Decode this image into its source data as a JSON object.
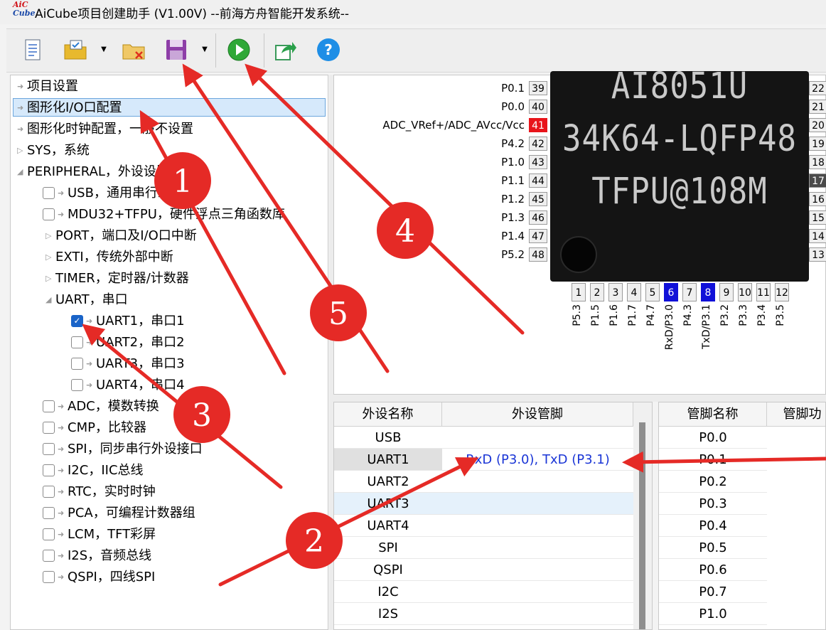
{
  "window": {
    "logo_text_top": "AiC",
    "logo_text_bottom": "Cube",
    "title": "AiCube项目创建助手 (V1.00V) --前海方舟智能开发系统--"
  },
  "toolbar": {
    "buttons": [
      {
        "icon": "new-document-icon"
      },
      {
        "icon": "open-folder-icon",
        "dropdown": true
      },
      {
        "icon": "close-project-icon"
      },
      {
        "icon": "save-icon",
        "dropdown": true
      },
      {
        "icon": "run-generate-icon"
      },
      {
        "icon": "export-icon"
      },
      {
        "icon": "help-icon"
      }
    ],
    "dropdown_glyph": "▼"
  },
  "tree": {
    "items": [
      {
        "label": "项目设置"
      },
      {
        "label": "图形化I/O口配置"
      },
      {
        "label": "图形化时钟配置，一般不设置"
      },
      {
        "label": "SYS，系统"
      },
      {
        "label": "PERIPHERAL，外设设置"
      },
      {
        "label": "USB，通用串行总线"
      },
      {
        "label": "MDU32+TFPU，硬件浮点三角函数库"
      },
      {
        "label": "PORT，端口及I/O口中断"
      },
      {
        "label": "EXTI，传统外部中断"
      },
      {
        "label": "TIMER，定时器/计数器"
      },
      {
        "label": "UART，串口"
      },
      {
        "label": "UART1，串口1"
      },
      {
        "label": "UART2，串口2"
      },
      {
        "label": "UART3，串口3"
      },
      {
        "label": "UART4，串口4"
      },
      {
        "label": "ADC，模数转换"
      },
      {
        "label": "CMP，比较器"
      },
      {
        "label": "SPI，同步串行外设接口"
      },
      {
        "label": "I2C，IIC总线"
      },
      {
        "label": "RTC，实时时钟"
      },
      {
        "label": "PCA，可编程计数器组"
      },
      {
        "label": "LCM，TFT彩屏"
      },
      {
        "label": "I2S，音频总线"
      },
      {
        "label": "QSPI，四线SPI"
      }
    ],
    "check_glyph": "✓"
  },
  "pinout": {
    "left_pins": [
      {
        "label": "P0.1",
        "num": "39"
      },
      {
        "label": "P0.0",
        "num": "40"
      },
      {
        "label": "ADC_VRef+/ADC_AVcc/Vcc",
        "num": "41"
      },
      {
        "label": "P4.2",
        "num": "42"
      },
      {
        "label": "P1.0",
        "num": "43"
      },
      {
        "label": "P1.1",
        "num": "44"
      },
      {
        "label": "P1.2",
        "num": "45"
      },
      {
        "label": "P1.3",
        "num": "46"
      },
      {
        "label": "P1.4",
        "num": "47"
      },
      {
        "label": "P5.2",
        "num": "48"
      }
    ],
    "right_pins": [
      "22",
      "21",
      "20",
      "19",
      "18",
      "17",
      "16",
      "15",
      "14",
      "13"
    ],
    "bottom_pins": [
      {
        "num": "1",
        "label": "P5.3"
      },
      {
        "num": "2",
        "label": "P1.5"
      },
      {
        "num": "3",
        "label": "P1.6"
      },
      {
        "num": "4",
        "label": "P1.7"
      },
      {
        "num": "5",
        "label": "P4.7"
      },
      {
        "num": "6",
        "label": "RxD/P3.0"
      },
      {
        "num": "7",
        "label": "P4.3"
      },
      {
        "num": "8",
        "label": "TxD/P3.1"
      },
      {
        "num": "9",
        "label": "P3.2"
      },
      {
        "num": "10",
        "label": "P3.3"
      },
      {
        "num": "11",
        "label": "P3.4"
      },
      {
        "num": "12",
        "label": "P3.5"
      }
    ],
    "chip_lines": [
      "AI8051U",
      "34K64-LQFP48",
      "TFPU@108M"
    ]
  },
  "peripheral_table": {
    "headers": [
      "外设名称",
      "外设管脚"
    ],
    "rows": [
      {
        "name": "USB",
        "pins": ""
      },
      {
        "name": "UART1",
        "pins": "RxD (P3.0), TxD (P3.1)"
      },
      {
        "name": "UART2",
        "pins": ""
      },
      {
        "name": "UART3",
        "pins": ""
      },
      {
        "name": "UART4",
        "pins": ""
      },
      {
        "name": "SPI",
        "pins": ""
      },
      {
        "name": "QSPI",
        "pins": ""
      },
      {
        "name": "I2C",
        "pins": ""
      },
      {
        "name": "I2S",
        "pins": ""
      }
    ]
  },
  "pin_table": {
    "headers": [
      "管脚名称",
      "管脚功"
    ],
    "rows": [
      "P0.0",
      "P0.1",
      "P0.2",
      "P0.3",
      "P0.4",
      "P0.5",
      "P0.6",
      "P0.7",
      "P1.0"
    ]
  },
  "annotations": {
    "badges": [
      "1",
      "2",
      "3",
      "4",
      "5"
    ],
    "color": "#e52a26"
  }
}
